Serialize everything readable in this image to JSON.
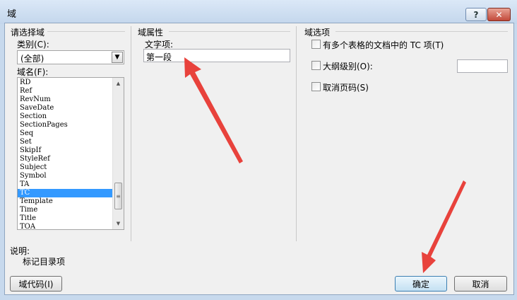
{
  "window": {
    "title": "域",
    "help_label": "?",
    "close_label": "✕"
  },
  "left_panel": {
    "heading": "请选择域",
    "category_label": "类别(C):",
    "category_value": "(全部)",
    "field_names_label": "域名(F):",
    "field_names": [
      "RD",
      "Ref",
      "RevNum",
      "SaveDate",
      "Section",
      "SectionPages",
      "Seq",
      "Set",
      "SkipIf",
      "StyleRef",
      "Subject",
      "Symbol",
      "TA",
      "TC",
      "Template",
      "Time",
      "Title",
      "TOA"
    ],
    "selected_field": "TC"
  },
  "middle_panel": {
    "heading": "域属性",
    "text_item_label": "文字项:",
    "text_item_value": "第一段"
  },
  "right_panel": {
    "heading": "域选项",
    "options": [
      {
        "label": "有多个表格的文档中的 TC 项(T)",
        "checked": false
      },
      {
        "label": "大纲级别(O):",
        "checked": false,
        "value": ""
      },
      {
        "label": "取消页码(S)",
        "checked": false
      }
    ]
  },
  "description": {
    "label": "说明:",
    "text": "标记目录项"
  },
  "buttons": {
    "field_codes": "域代码(I)",
    "ok": "确定",
    "cancel": "取消"
  },
  "icons": {
    "dropdown": "chevron-down-icon",
    "scroll_up": "scroll-up-icon",
    "scroll_down": "scroll-down-icon"
  },
  "colors": {
    "selection": "#3399ff",
    "annotation_arrow": "#e8423c"
  }
}
